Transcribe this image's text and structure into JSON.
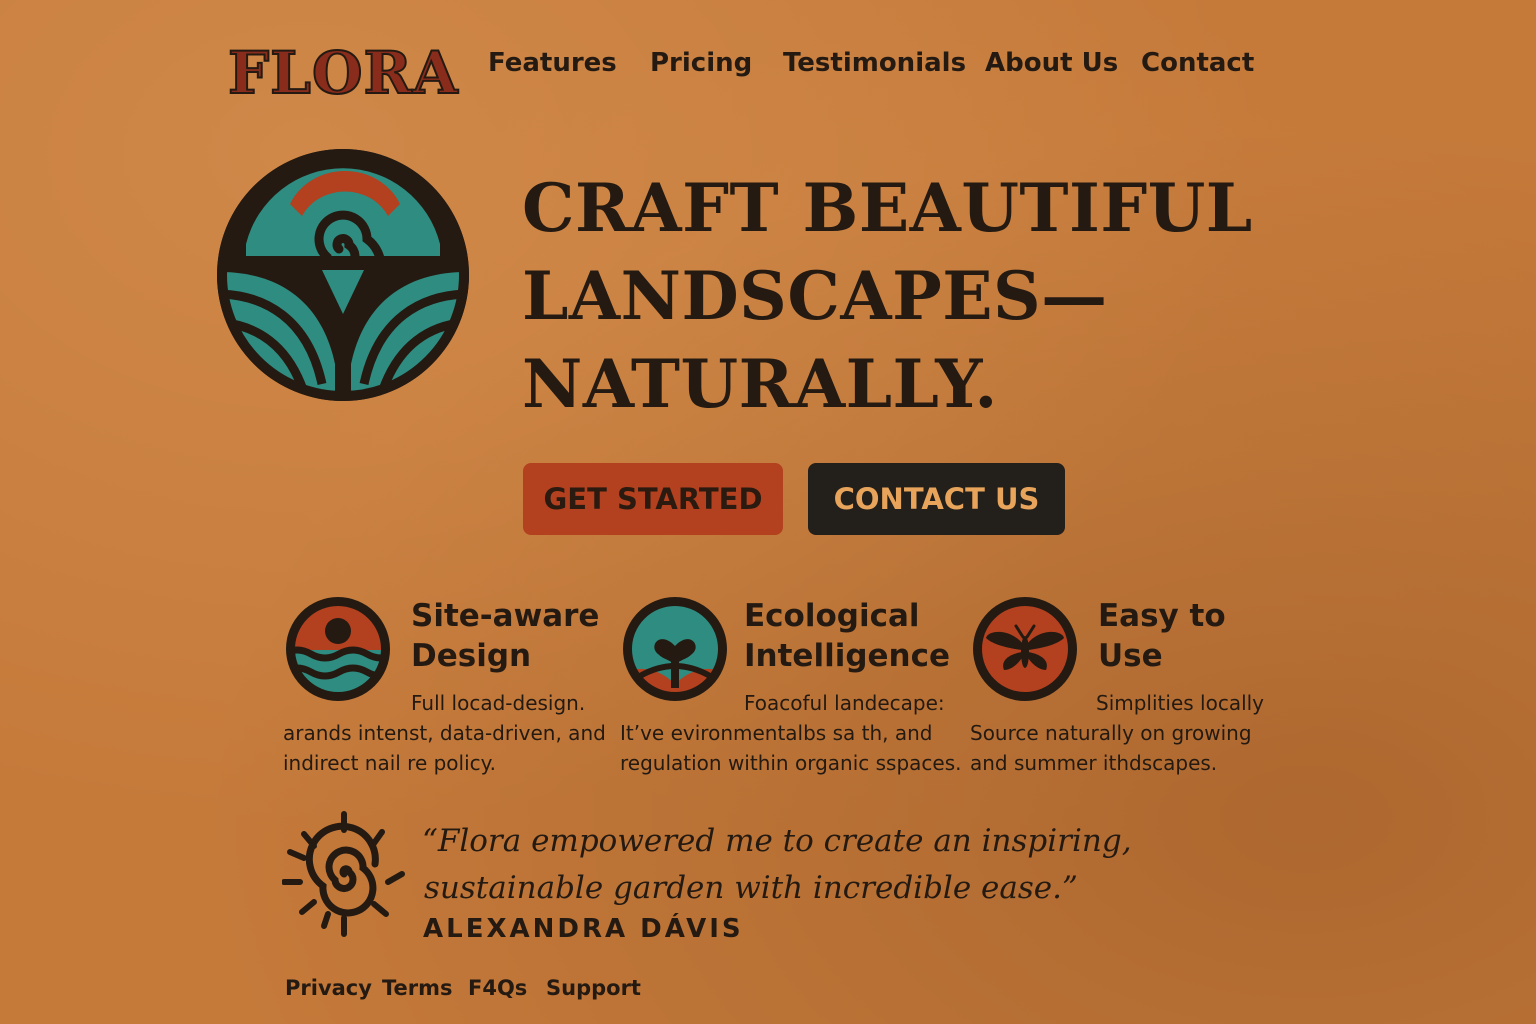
{
  "brand": {
    "name": "FLORA"
  },
  "nav": {
    "items": [
      {
        "label": "Features"
      },
      {
        "label": "Pricing"
      },
      {
        "label": "Testimonials"
      },
      {
        "label": "About Us"
      },
      {
        "label": "Contact"
      }
    ]
  },
  "hero": {
    "title_lines": [
      "CRAFT BEAUTIFUL",
      "LANDSCAPES—",
      "NATURALLY."
    ],
    "primary_button": "GET STARTED",
    "secondary_button": "CONTACT US"
  },
  "features": [
    {
      "title_lines": [
        "Site-aware",
        "Design"
      ],
      "desc_lines": [
        "Full locad-design.",
        "arands intenst, data-driven, and",
        "indirect nail re policy."
      ],
      "icon": "sun-over-water-icon"
    },
    {
      "title_lines": [
        "Ecological",
        "Intelligence"
      ],
      "desc_lines": [
        "Foacoful landecape:",
        "It’ve evironmentalbs sa  th, and",
        "regulation within organic sspaces."
      ],
      "icon": "heart-plant-icon"
    },
    {
      "title_lines": [
        "Easy to",
        "Use"
      ],
      "desc_lines": [
        "Simplities locally",
        "Source naturally on growing",
        "and summer ithdscapes."
      ],
      "icon": "butterfly-icon"
    }
  ],
  "testimonial": {
    "quote_lines": [
      "“Flora empowered me to create an inspiring,",
      "sustainable garden with incredible ease.”"
    ],
    "author": "ALEXANDRA DÁVIS",
    "icon": "spiral-sun-icon"
  },
  "footer": {
    "links": [
      {
        "label": "Privacy"
      },
      {
        "label": "Terms"
      },
      {
        "label": "F4Qs"
      },
      {
        "label": "Support"
      }
    ]
  },
  "colors": {
    "background": "#c57a3a",
    "ink": "#241a12",
    "rust": "#b3401e",
    "teal": "#2f8c80",
    "dark_button": "#231f1b",
    "button_text_light": "#e7a45a"
  }
}
